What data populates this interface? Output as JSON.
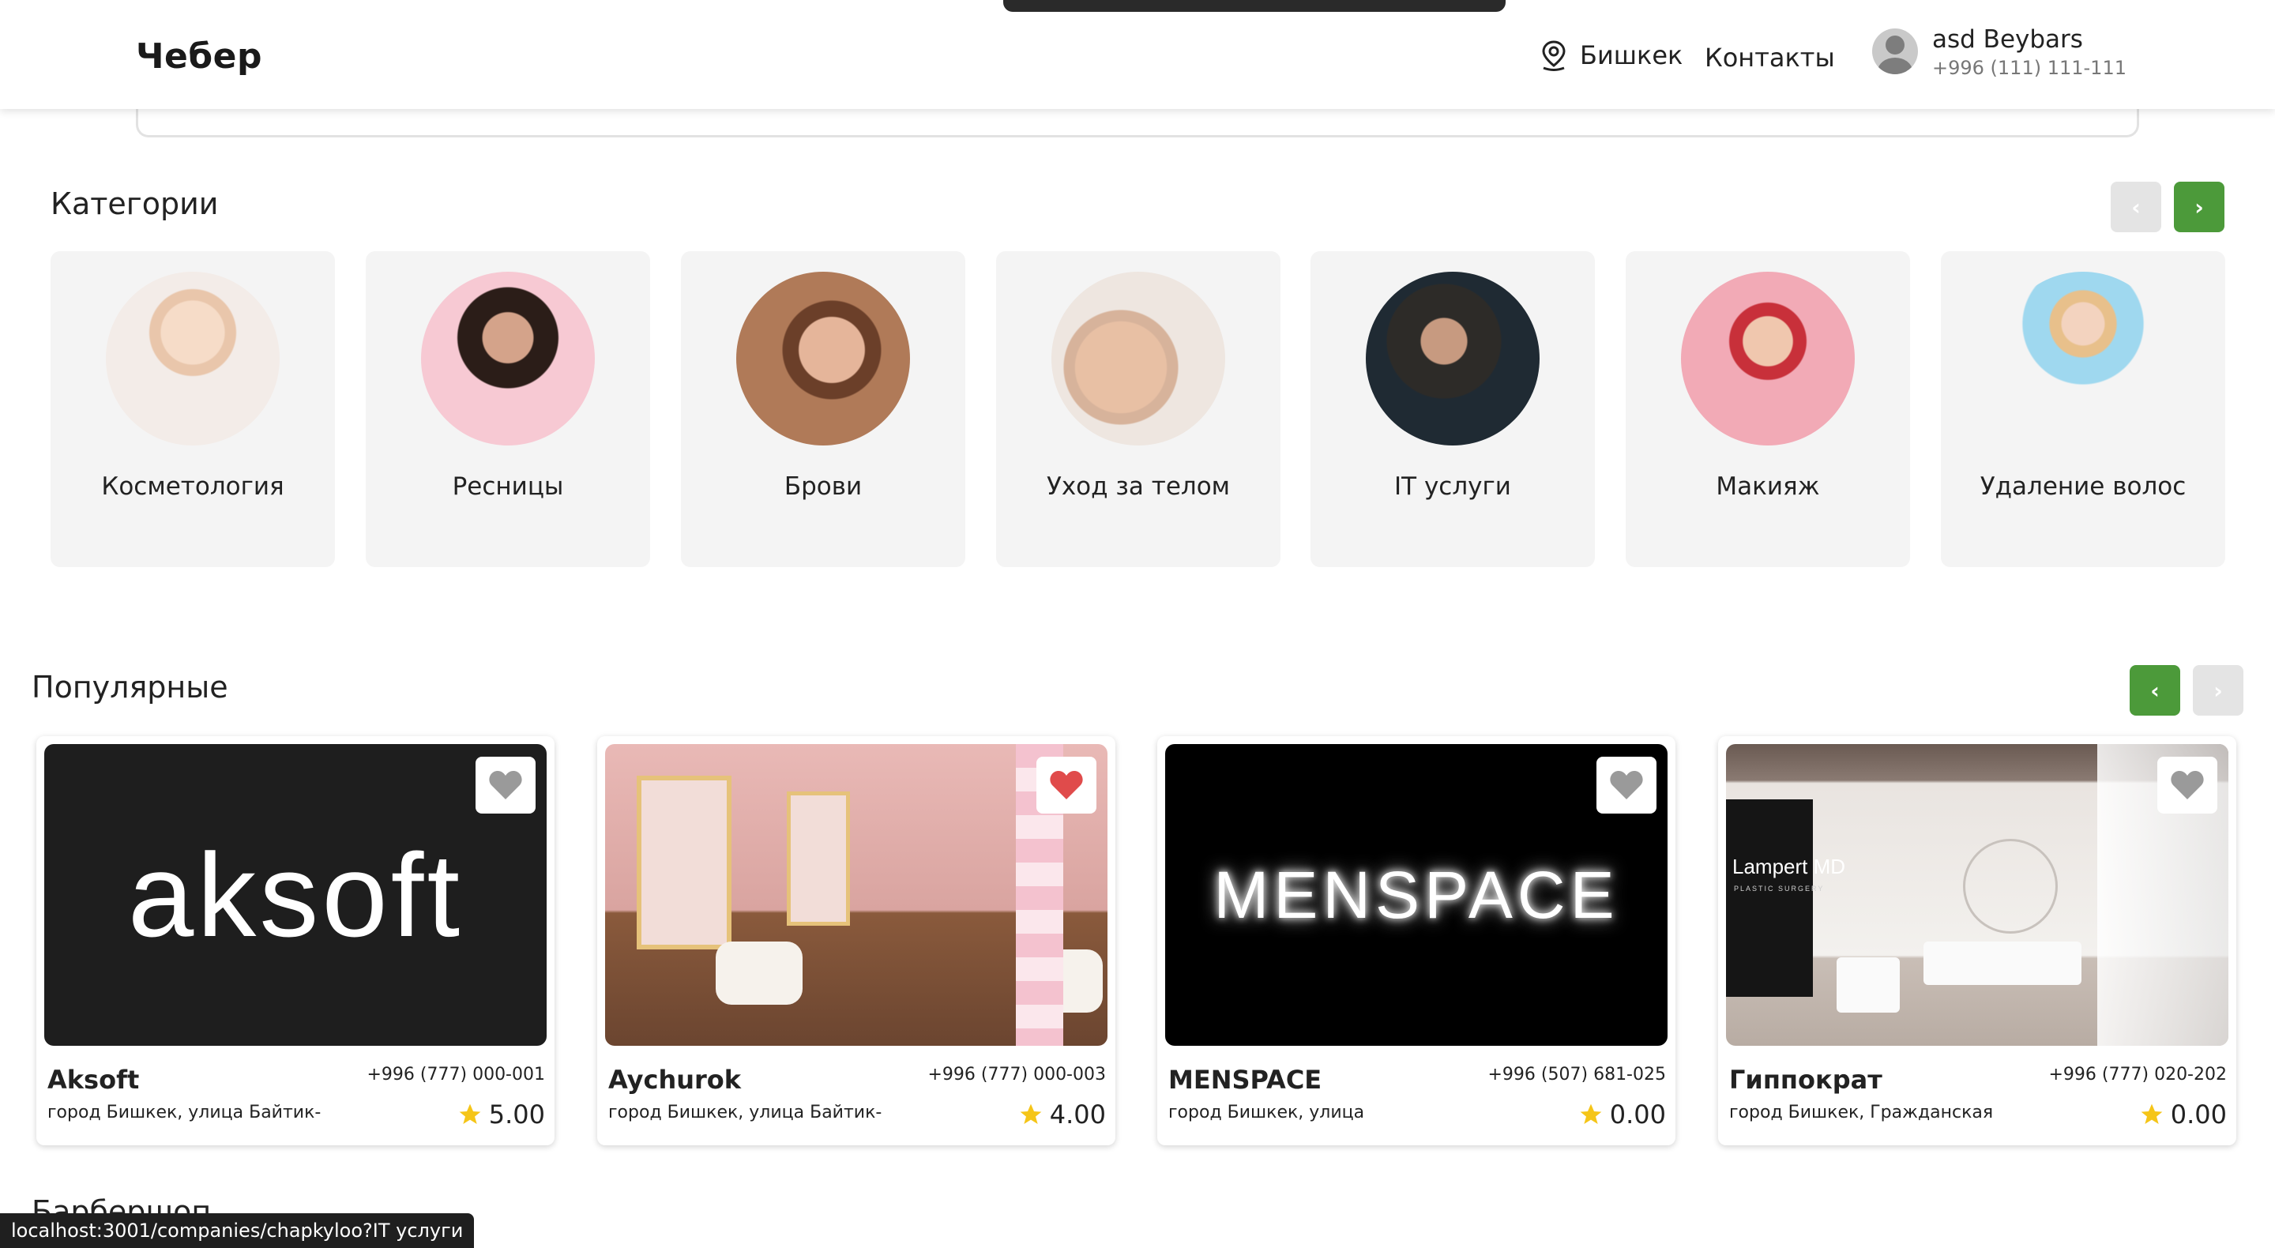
{
  "header": {
    "logo": "Чебер",
    "city": "Бишкек",
    "contacts": "Контакты",
    "user_name": "asd Beybars",
    "user_phone": "+996 (111) 111-111"
  },
  "categories": {
    "title": "Категории",
    "items": [
      {
        "label": "Косметология"
      },
      {
        "label": "Ресницы"
      },
      {
        "label": "Брови"
      },
      {
        "label": "Уход за телом"
      },
      {
        "label": "IT услуги"
      },
      {
        "label": "Макияж"
      },
      {
        "label": "Удаление волос"
      }
    ]
  },
  "popular": {
    "title": "Популярные",
    "items": [
      {
        "name": "Aksoft",
        "phone": "+996 (777) 000-001",
        "address": "город Бишкек, улица Байтик-",
        "rating": "5.00",
        "favorited": false,
        "image_text": "aksoft"
      },
      {
        "name": "Aychurok",
        "phone": "+996 (777) 000-003",
        "address": "город Бишкек, улица Байтик-",
        "rating": "4.00",
        "favorited": true
      },
      {
        "name": "MENSPACE",
        "phone": "+996 (507) 681-025",
        "address": "город Бишкек, улица",
        "rating": "0.00",
        "favorited": false,
        "image_text": "MENSPACE"
      },
      {
        "name": "Гиппократ",
        "phone": "+996 (777) 020-202",
        "address": "город Бишкек, Гражданская",
        "rating": "0.00",
        "favorited": false,
        "image_text": "Lampert MD",
        "image_subtext": "PLASTIC SURGERY"
      }
    ]
  },
  "next_section": {
    "title": "Барбершоп"
  },
  "status_bar": {
    "url": "localhost:3001/companies/chapkyloo?IT услуги"
  },
  "colors": {
    "accent": "#4c9a3a",
    "heart_active": "#e04b4b",
    "heart_inactive": "#9a9a9a",
    "star": "#f5c518"
  }
}
